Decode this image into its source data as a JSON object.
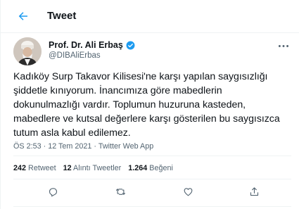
{
  "header": {
    "title": "Tweet",
    "back_icon": "arrow-left-icon"
  },
  "author": {
    "name": "Prof. Dr. Ali Erbaş",
    "handle": "@DIBAliErbas",
    "verified_icon": "verified-badge-icon",
    "avatar_icon": "avatar-image"
  },
  "tweet": {
    "text": "Kadıköy Surp Takavor Kilisesi'ne karşı yapılan saygısızlığı şiddetle kınıyorum. İnancımıza göre mabedlerin dokunulmazlığı vardır. Toplumun huzuruna kasteden, mabedlere ve kutsal değerlere karşı gösterilen bu saygısızca tutum asla kabul edilemez.",
    "meta": "ÖS 2:53 · 12 Tem 2021 · Twitter Web App"
  },
  "stats": {
    "retweets_count": "242",
    "retweets_label": "Retweet",
    "quotes_count": "12",
    "quotes_label": "Alıntı Tweetler",
    "likes_count": "1.264",
    "likes_label": "Beğeni"
  },
  "actions": [
    "reply-icon",
    "retweet-icon",
    "like-icon",
    "share-icon"
  ],
  "colors": {
    "accent": "#1d9bf0",
    "muted": "#536471",
    "divider": "#eff3f4"
  }
}
